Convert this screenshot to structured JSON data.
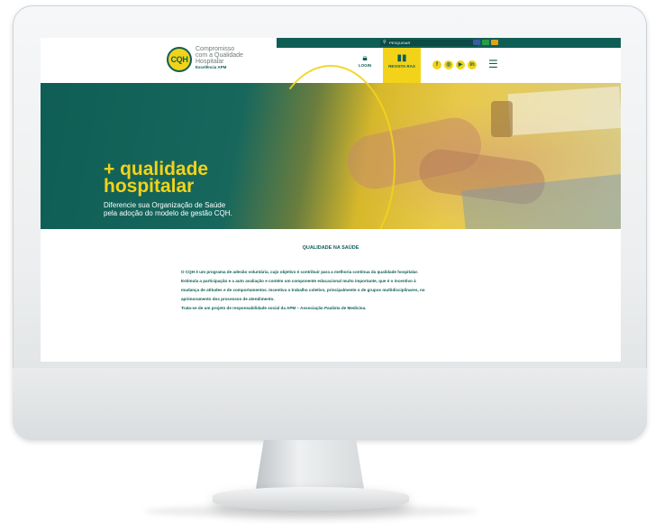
{
  "site": {
    "logo_text": "CQH",
    "brand_lines": [
      "Compromisso",
      "com a Qualidade",
      "Hospitalar"
    ],
    "brand_sub": "Excelência APM",
    "search_label": "PESQUISAR",
    "login_label": "LOGIN",
    "revista_label": "REVISTA RAS",
    "social": [
      "f",
      "◎",
      "▶",
      "in"
    ],
    "icons": {
      "search": "search-icon",
      "login": "lock-icon",
      "revista": "book-icon",
      "menu": "hamburger-menu-icon"
    }
  },
  "hero": {
    "title_line1": "+ qualidade",
    "title_line2": "hospitalar",
    "subtitle": "Diferencie sua Organização de Saúde pela adoção do modelo de gestão CQH."
  },
  "content": {
    "section_title": "QUALIDADE NA SAÚDE",
    "paragraph_lines": [
      "O CQH é um programa de adesão voluntária, cujo objetivo é contribuir para a melhoria contínua da qualidade hospitalar.",
      "Estimula a participação e a auto avaliação e contém um componente educacional muito importante, que é o incentivo à",
      "mudança de atitudes e de comportamentos. Incentiva o trabalho coletivo, principalmente o de grupos multidisciplinares, no",
      "aprimoramento dos processos de atendimento.",
      "Trata-se de um projeto de responsabilidade social da APM – Associação Paulista de Medicina."
    ]
  },
  "colors": {
    "primary_green": "#0f5e55",
    "accent_yellow": "#f2d31a",
    "flags": [
      "#3b5ba5",
      "#2e9b45",
      "#e0a21b"
    ]
  }
}
